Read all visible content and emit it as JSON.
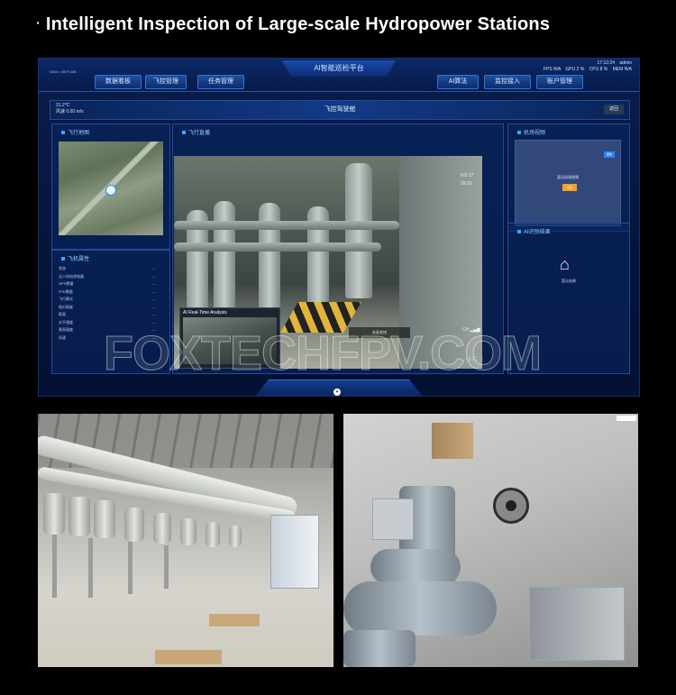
{
  "headline": {
    "bullet": "·",
    "text": "Intelligent Inspection of Large-scale Hydropower Stations"
  },
  "dashboard": {
    "platform_title": "AI智能巡检平台",
    "corner_label": "0304 × 88 FC6N",
    "nav_tabs": [
      "数据看板",
      "飞控管理",
      "任务管理",
      "AI算法",
      "监控接入",
      "账户管理"
    ],
    "system_stats": {
      "time": "17:12:24",
      "user": "admin",
      "line2": [
        "FPS N/A",
        "GPU 2 %",
        "CPU 8 %",
        "MEM N/A"
      ]
    },
    "page_title": "飞控驾驶舱",
    "back_button": "返回",
    "weather": {
      "temperature": "31.2°C",
      "wind": "风速 0.00 m/s"
    },
    "left_panels": {
      "map_title": "飞行地图",
      "attributes_title": "飞机属性",
      "attributes": [
        {
          "label": "状态",
          "value": "—"
        },
        {
          "label": "无人机电池电量",
          "value": "—"
        },
        {
          "label": "GPS数量",
          "value": "—"
        },
        {
          "label": "RTK数量",
          "value": "—"
        },
        {
          "label": "飞行模式",
          "value": "—"
        },
        {
          "label": "相对高度",
          "value": "—"
        },
        {
          "label": "距离",
          "value": "—"
        },
        {
          "label": "水平速度",
          "value": "—"
        },
        {
          "label": "垂直速度",
          "value": "—"
        },
        {
          "label": "风速",
          "value": "—"
        }
      ]
    },
    "video_panel": {
      "title": "飞行直播",
      "info_lines": [
        "NO 17",
        "29.02"
      ],
      "ai_inset_title": "AI Real-Time Analysis",
      "status_text": "准备就绪",
      "signal_label": "CH"
    },
    "right_panels": {
      "hangar_title": "机场视频",
      "hangar_button": "播放",
      "hangar_text": "暂无机场视频",
      "hangar_warning": "离线",
      "ai_result_title": "AI识别结果",
      "ai_result_label": "暂无结果"
    },
    "watermark": "FOXTECHFPV.COM"
  },
  "photos": {
    "left_alt": "switchgear hall",
    "right_alt": "drone inspecting GIS equipment"
  }
}
